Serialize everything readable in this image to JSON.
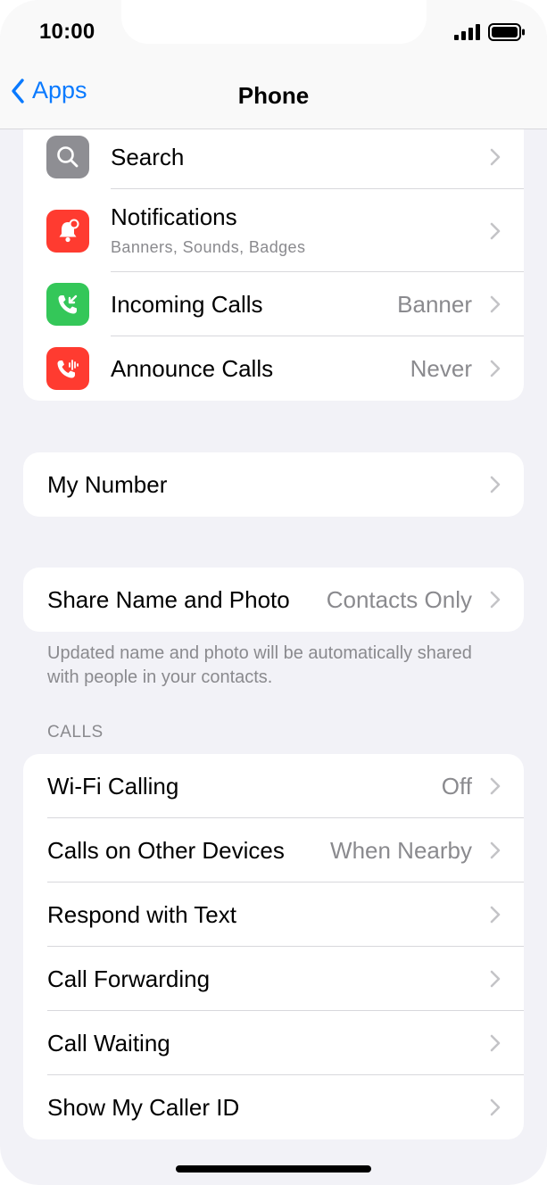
{
  "status": {
    "time": "10:00"
  },
  "nav": {
    "back_label": "Apps",
    "title": "Phone"
  },
  "colors": {
    "accent": "#0a7aff",
    "search_icon_bg": "#8e8e93",
    "notifications_icon_bg": "#ff3b30",
    "incoming_icon_bg": "#34c759",
    "announce_icon_bg": "#ff3b30"
  },
  "app_group": {
    "items": [
      {
        "label": "Search",
        "icon": "magnifier-icon"
      },
      {
        "label": "Notifications",
        "subtitle": "Banners, Sounds, Badges",
        "icon": "bell-icon"
      },
      {
        "label": "Incoming Calls",
        "value": "Banner",
        "icon": "incoming-call-icon"
      },
      {
        "label": "Announce Calls",
        "value": "Never",
        "icon": "announce-call-icon"
      }
    ]
  },
  "my_number": {
    "label": "My Number"
  },
  "share": {
    "label": "Share Name and Photo",
    "value": "Contacts Only",
    "footnote": "Updated name and photo will be automatically shared with people in your contacts."
  },
  "calls": {
    "header": "CALLS",
    "items": [
      {
        "label": "Wi-Fi Calling",
        "value": "Off"
      },
      {
        "label": "Calls on Other Devices",
        "value": "When Nearby"
      },
      {
        "label": "Respond with Text"
      },
      {
        "label": "Call Forwarding"
      },
      {
        "label": "Call Waiting"
      },
      {
        "label": "Show My Caller ID"
      }
    ]
  }
}
